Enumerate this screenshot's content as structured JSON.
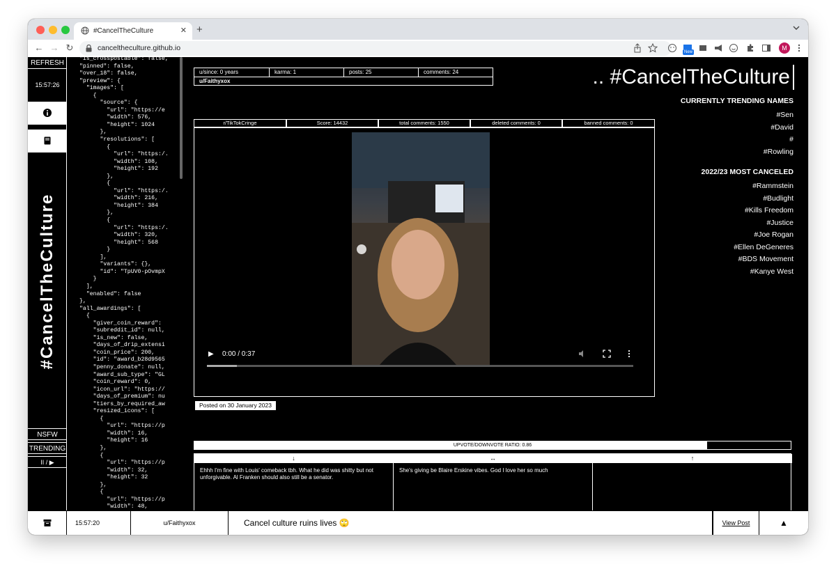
{
  "browser": {
    "tab_title": "#CancelTheCulture",
    "url": "canceltheculture.github.io",
    "new_badge": "New",
    "avatar_initial": "M"
  },
  "sidebar": {
    "refresh_label": "REFRESH",
    "time": "15:57:26",
    "vertical_title": "#CancelTheCulture",
    "nsfw_label": "NSFW",
    "trending_label": "TRENDING",
    "play_pause_label": "II / ▶"
  },
  "json_text": "\"is_crosspostable\": false,\n\"pinned\": false,\n\"over_18\": false,\n\"preview\": {\n  \"images\": [\n    {\n      \"source\": {\n        \"url\": \"https://e\n        \"width\": 576,\n        \"height\": 1024\n      },\n      \"resolutions\": [\n        {\n          \"url\": \"https:/.\n          \"width\": 108,\n          \"height\": 192\n        },\n        {\n          \"url\": \"https:/.\n          \"width\": 216,\n          \"height\": 384\n        },\n        {\n          \"url\": \"https:/.\n          \"width\": 320,\n          \"height\": 568\n        }\n      ],\n      \"variants\": {},\n      \"id\": \"TpUV0-pOvmpX\n    }\n  ],\n  \"enabled\": false\n},\n\"all_awardings\": [\n  {\n    \"giver_coin_reward\": \n    \"subreddit_id\": null,\n    \"is_new\": false,\n    \"days_of_drip_extensi\n    \"coin_price\": 200,\n    \"id\": \"award_b28d9565\n    \"penny_donate\": null,\n    \"award_sub_type\": \"GL\n    \"coin_reward\": 0,\n    \"icon_url\": \"https://\n    \"days_of_premium\": nu\n    \"tiers_by_required_aw\n    \"resized_icons\": [\n      {\n        \"url\": \"https://p\n        \"width\": 16,\n        \"height\": 16\n      },\n      {\n        \"url\": \"https://p\n        \"width\": 32,\n        \"height\": 32\n      },\n      {\n        \"url\": \"https://p\n        \"width\": 48,",
  "user": {
    "since": "u/since: 0 years",
    "karma": "karma: 1",
    "posts": "posts: 25",
    "comments": "comments: 24",
    "name": "u/Faithyxox"
  },
  "site_title": ".. #CancelTheCulture",
  "trending": {
    "heading": "CURRENTLY TRENDING NAMES",
    "tags": [
      "#Sen",
      "#David",
      "#",
      "#Rowling"
    ]
  },
  "most_canceled": {
    "heading": "2022/23 MOST CANCELED",
    "tags": [
      "#Rammstein",
      "#Budlight",
      "#Kills Freedom",
      "#Justice",
      "#Joe Rogan",
      "#Ellen DeGeneres",
      "#BDS Movement",
      "#Kanye West"
    ]
  },
  "post": {
    "subreddit": "r/TikTokCringe",
    "score": "Score: 14432",
    "total_comments": "total comments: 1550",
    "deleted_comments": "deleted comments: 0",
    "banned_comments": "banned comments: 0",
    "posted_on": "Posted on 30 January 2023",
    "video_time": "0:00 / 0:37",
    "video_progress": 0.07
  },
  "ratio": {
    "label": "UPVOTE/DOWNVOTE RATIO: 0.86",
    "value": 0.86
  },
  "comments": [
    {
      "header": "↓",
      "text": "Ehhh I'm fine with Louis' comeback tbh. What he did was shitty but not unforgivable. Al Franken should also still be a senator."
    },
    {
      "header": "↔",
      "text": "She's giving be Blaire Erskine vibes. God I love her so much"
    },
    {
      "header": "↑",
      "text": ""
    }
  ],
  "footer": {
    "time": "15:57:20",
    "user": "u/Faithyxox",
    "message": "Cancel culture ruins lives 🙄",
    "view_post": "View Post",
    "up_arrow": "▲"
  }
}
